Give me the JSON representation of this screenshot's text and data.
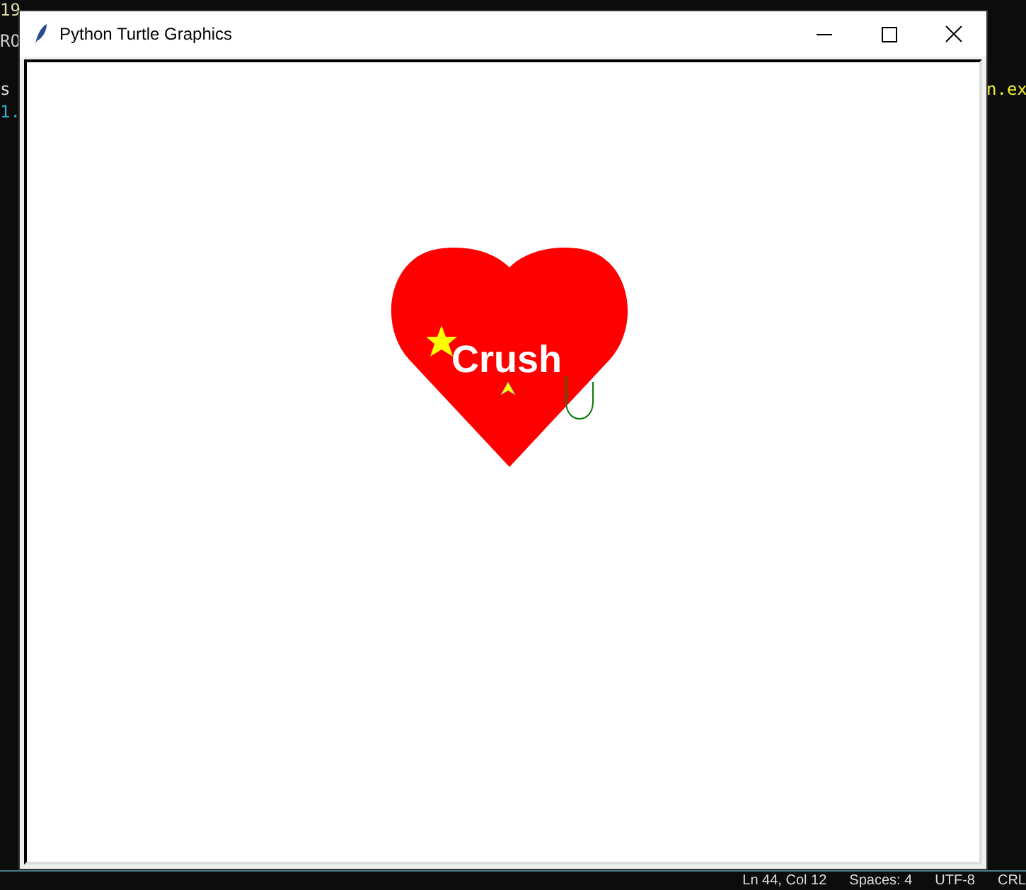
{
  "background_editor": {
    "fragments": [
      "19",
      "RO",
      "s",
      "1.",
      "n.ex"
    ]
  },
  "window": {
    "title": "Python Turtle Graphics"
  },
  "canvas": {
    "label": "Crush"
  },
  "status_bar": {
    "items": [
      "Ln 44, Col 12",
      "Spaces: 4",
      "UTF-8",
      "CRL"
    ]
  }
}
